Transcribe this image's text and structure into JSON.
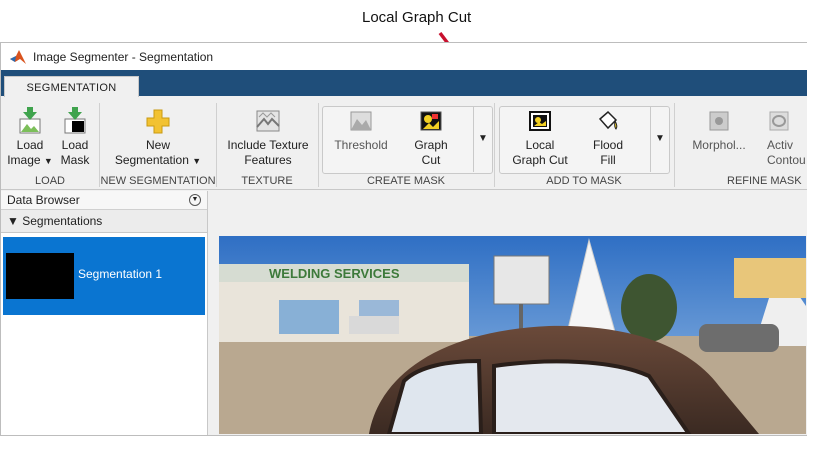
{
  "annotation": {
    "text": "Local Graph Cut"
  },
  "window": {
    "title": "Image Segmenter - Segmentation"
  },
  "tabs": [
    {
      "label": "SEGMENTATION"
    }
  ],
  "ribbon": {
    "load": {
      "label": "LOAD",
      "load_image": {
        "line1": "Load",
        "line2": "Image"
      },
      "load_mask": {
        "line1": "Load",
        "line2": "Mask"
      }
    },
    "new_segmentation": {
      "label": "NEW SEGMENTATION",
      "button": {
        "line1": "New",
        "line2": "Segmentation"
      }
    },
    "texture": {
      "label": "TEXTURE",
      "button": {
        "line1": "Include Texture",
        "line2": "Features"
      }
    },
    "create_mask": {
      "label": "CREATE MASK",
      "threshold": "Threshold",
      "graph_cut": {
        "line1": "Graph",
        "line2": "Cut"
      }
    },
    "add_to_mask": {
      "label": "ADD TO MASK",
      "local_graph_cut": {
        "line1": "Local",
        "line2": "Graph Cut"
      },
      "flood_fill": {
        "line1": "Flood",
        "line2": "Fill"
      }
    },
    "refine_mask": {
      "label": "REFINE MASK",
      "morphology": "Morphol...",
      "active_contours": {
        "line1": "Activ",
        "line2": "Contou"
      }
    }
  },
  "data_browser": {
    "title": "Data Browser",
    "section": "Segmentations",
    "items": [
      {
        "name": "Segmentation 1"
      }
    ]
  },
  "photo": {
    "sign_text": "WELDING SERVICES"
  },
  "colors": {
    "accent": "#0a75d1",
    "tab_band": "#1f4e7a",
    "annotation_arrow": "#c8102e"
  }
}
